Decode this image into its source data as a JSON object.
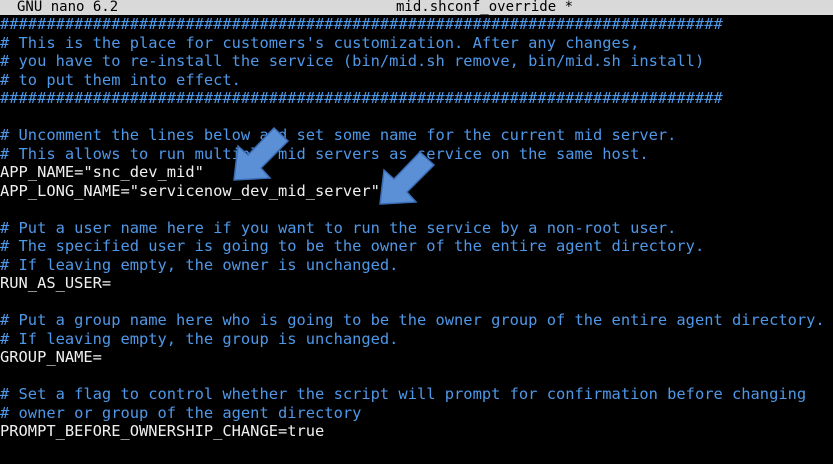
{
  "titlebar": {
    "app_name": "GNU nano 6.2",
    "file_name": "mid.shconf_override *"
  },
  "lines": [
    {
      "type": "comment",
      "text": "##############################################################################"
    },
    {
      "type": "comment",
      "text": "# This is the place for customers's customization. After any changes,"
    },
    {
      "type": "comment",
      "text": "# you have to re-install the service (bin/mid.sh remove, bin/mid.sh install)"
    },
    {
      "type": "comment",
      "text": "# to put them into effect."
    },
    {
      "type": "comment",
      "text": "##############################################################################"
    },
    {
      "type": "blank",
      "text": ""
    },
    {
      "type": "comment",
      "text": "# Uncomment the lines below and set some name for the current mid server."
    },
    {
      "type": "comment",
      "text": "# This allows to run multiple mid servers as service on the same host."
    },
    {
      "type": "code",
      "text": "APP_NAME=\"snc_dev_mid\""
    },
    {
      "type": "code",
      "text": "APP_LONG_NAME=\"servicenow_dev_mid_server\""
    },
    {
      "type": "blank",
      "text": ""
    },
    {
      "type": "comment",
      "text": "# Put a user name here if you want to run the service by a non-root user."
    },
    {
      "type": "comment",
      "text": "# The specified user is going to be the owner of the entire agent directory."
    },
    {
      "type": "comment",
      "text": "# If leaving empty, the owner is unchanged."
    },
    {
      "type": "code",
      "text": "RUN_AS_USER="
    },
    {
      "type": "blank",
      "text": ""
    },
    {
      "type": "comment",
      "text": "# Put a group name here who is going to be the owner group of the entire agent directory."
    },
    {
      "type": "comment",
      "text": "# If leaving empty, the group is unchanged."
    },
    {
      "type": "code",
      "text": "GROUP_NAME="
    },
    {
      "type": "blank",
      "text": ""
    },
    {
      "type": "comment",
      "text": "# Set a flag to control whether the script will prompt for confirmation before changing"
    },
    {
      "type": "comment",
      "text": "# owner or group of the agent directory"
    },
    {
      "type": "code",
      "text": "PROMPT_BEFORE_OWNERSHIP_CHANGE=true"
    }
  ],
  "annotations": {
    "arrow_color": "#5b8fd6",
    "arrow_outline": "#3a6db5"
  }
}
